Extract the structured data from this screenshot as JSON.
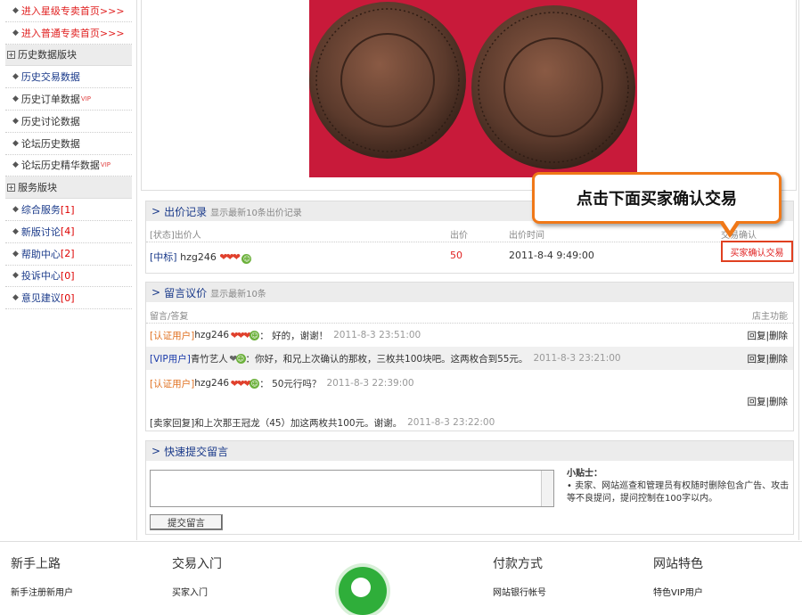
{
  "sidebar": {
    "promo": [
      {
        "label": "进入星级专卖首页>>>"
      },
      {
        "label": "进入普通专卖首页>>>"
      }
    ],
    "history_header": "历史数据版块",
    "history_items": [
      {
        "label": "历史交易数据",
        "vip": ""
      },
      {
        "label": "历史订单数据",
        "vip": "VIP"
      },
      {
        "label": "历史讨论数据",
        "vip": ""
      },
      {
        "label": "论坛历史数据",
        "vip": ""
      },
      {
        "label": "论坛历史精华数据",
        "vip": "VIP"
      }
    ],
    "service_header": "服务版块",
    "service_items": [
      {
        "label": "综合服务",
        "count": "[1]"
      },
      {
        "label": "新版讨论",
        "count": "[4]"
      },
      {
        "label": "帮助中心",
        "count": "[2]"
      },
      {
        "label": "投诉中心",
        "count": "[0]"
      },
      {
        "label": "意见建议",
        "count": "[0]"
      }
    ]
  },
  "callout": {
    "text": "点击下面买家确认交易"
  },
  "bids": {
    "title": "出价记录",
    "subtitle": "显示最新10条出价记录",
    "col_bidder": "[状态]出价人",
    "col_price": "出价",
    "col_time": "出价时间",
    "col_confirm": "交易确认",
    "rows": [
      {
        "status": "[中标]",
        "user": "hzg246",
        "price": "50",
        "time": "2011-8-4 9:49:00",
        "action": "买家确认交易"
      }
    ]
  },
  "comments": {
    "title": "留言议价",
    "subtitle": "显示最新10条",
    "col_msg": "留言/答复",
    "col_func": "店主功能",
    "reply_label": "回复",
    "delete_label": "删除",
    "rows": [
      {
        "tag": "[认证用户]",
        "user": "hzg246",
        "text": "： 好的，谢谢！",
        "time": "2011-8-3 23:51:00"
      },
      {
        "tag": "[VIP用户]",
        "user": "青竹艺人",
        "text": "：你好，和兄上次确认的那枚，三枚共100块吧。这两枚合到55元。",
        "time": "2011-8-3 23:21:00"
      },
      {
        "tag": "[认证用户]",
        "user": "hzg246",
        "text": "： 50元行吗？",
        "time": "2011-8-3 22:39:00"
      }
    ],
    "seller_reply": {
      "text": "[卖家回复]和上次那王冠龙（45）加这两枚共100元。谢谢。",
      "time": "2011-8-3 23:22:00"
    }
  },
  "quick": {
    "title": "快速提交留言",
    "tips_title": "小贴士：",
    "tips_text": "• 卖家、网站巡查和管理员有权随时删除包含广告、攻击等不良提问，提问控制在100字以内。",
    "submit_label": "提交留言"
  },
  "footer": [
    {
      "title": "新手上路",
      "sub": "新手注册新用户"
    },
    {
      "title": "交易入门",
      "sub": "买家入门"
    },
    {
      "title": "付款方式",
      "sub": "网站银行帐号"
    },
    {
      "title": "网站特色",
      "sub": "特色VIP用户"
    }
  ]
}
